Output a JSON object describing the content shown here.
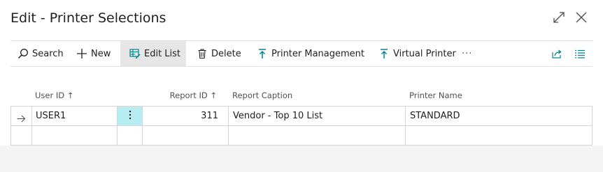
{
  "window": {
    "title": "Edit - Printer Selections",
    "expand_icon": "expand-icon",
    "close_icon": "close-icon"
  },
  "actions": {
    "search": "Search",
    "new": "New",
    "edit_list": "Edit List",
    "delete": "Delete",
    "printer_management": "Printer Management",
    "virtual_printer": "Virtual Printer",
    "more": "···"
  },
  "columns": {
    "user_id": "User ID ↑",
    "report_id": "Report ID ↑",
    "report_caption": "Report Caption",
    "printer_name": "Printer Name"
  },
  "rows": [
    {
      "user_id": "USER1",
      "report_id": "311",
      "report_caption": "Vendor - Top 10 List",
      "printer_name": "STANDARD"
    }
  ],
  "colors": {
    "accent": "#00828f",
    "selected_cell": "#b6ecf2",
    "active_action": "#e6e6e6"
  }
}
